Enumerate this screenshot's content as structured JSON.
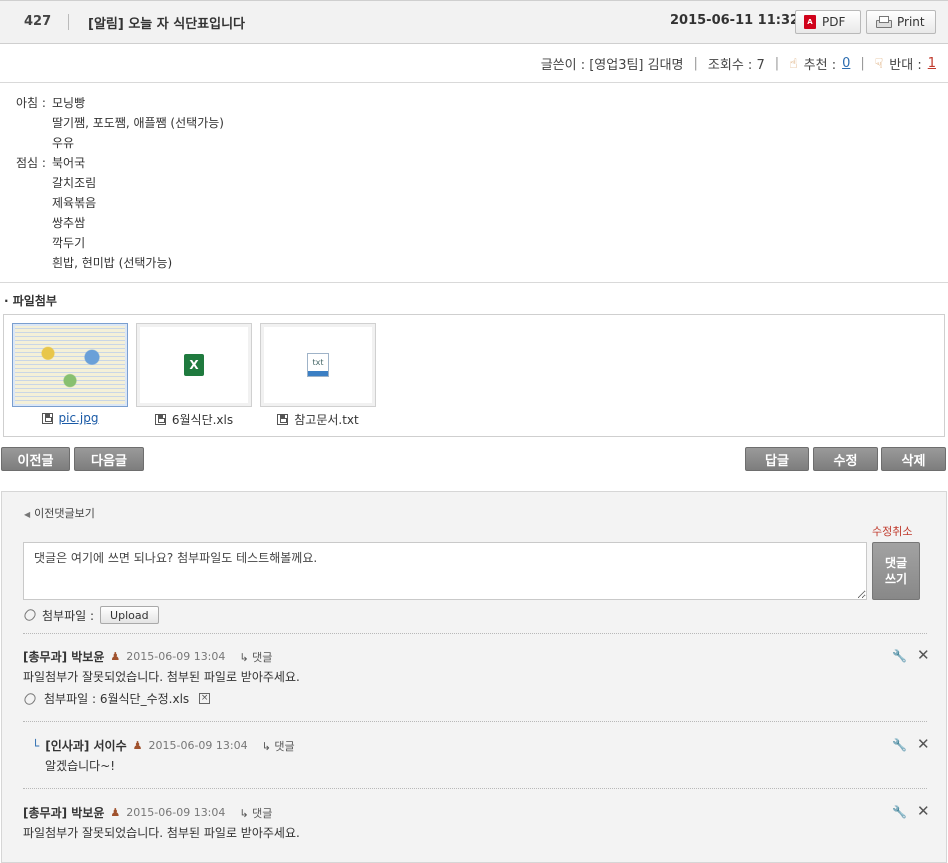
{
  "post": {
    "number": "427",
    "title": "[알림] 오늘 자 식단표입니다",
    "date": "2015-06-11 11:32",
    "pdf_label": "PDF",
    "print_label": "Print"
  },
  "meta": {
    "author_label": "글쓴이 : [영업3팀] 김대명",
    "views_label": "조회수 : 7",
    "recommend_label": "추천 :",
    "recommend_count": "0",
    "oppose_label": "반대 :",
    "oppose_count": "1",
    "sep": "|"
  },
  "menu": [
    {
      "cat": "아침 :",
      "item": "모닝빵"
    },
    {
      "cat": "",
      "item": "딸기쨈, 포도쨈, 애플쨈 (선택가능)"
    },
    {
      "cat": "",
      "item": "우유"
    },
    {
      "cat": "점심 :",
      "item": "북어국"
    },
    {
      "cat": "",
      "item": "갈치조림"
    },
    {
      "cat": "",
      "item": "제육볶음"
    },
    {
      "cat": "",
      "item": "쌍추쌈"
    },
    {
      "cat": "",
      "item": "깍두기"
    },
    {
      "cat": "",
      "item": "흰밥, 현미밥 (선택가능)"
    }
  ],
  "attachments": {
    "title": "· 파일첨부",
    "files": [
      {
        "name": "pic.jpg",
        "icon": "image-thumbnail"
      },
      {
        "name": "6월식단.xls",
        "icon": "excel-icon",
        "glyph": "X"
      },
      {
        "name": "참고문서.txt",
        "icon": "txt-icon",
        "glyph": "txt"
      }
    ]
  },
  "nav": {
    "prev": "이전글",
    "next": "다음글",
    "reply": "답글",
    "edit": "수정",
    "delete": "삭제"
  },
  "comments": {
    "prev_link": "이전댓글보기",
    "cancel_edit": "수정취소",
    "input_value": "댓글은 여기에 쓰면 되나요? 첨부파일도 테스트해볼께요.",
    "submit_label": "댓글\n쓰기",
    "attach_label": "첨부파일 :",
    "upload_label": "Upload",
    "reply_link": "↳ 댓글",
    "list": [
      {
        "author": "[총무과] 박보윤",
        "date": "2015-06-09 13:04",
        "text": "파일첨부가 잘못되었습니다. 첨부된 파일로 받아주세요.",
        "attachment": "첨부파일 : 6월식단_수정.xls"
      },
      {
        "author": "[인사과] 서이수",
        "date": "2015-06-09 13:04",
        "text": "알겠습니다~!"
      },
      {
        "author": "[총무과] 박보윤",
        "date": "2015-06-09 13:04",
        "text": "파일첨부가 잘못되었습니다. 첨부된 파일로 받아주세요."
      }
    ]
  }
}
